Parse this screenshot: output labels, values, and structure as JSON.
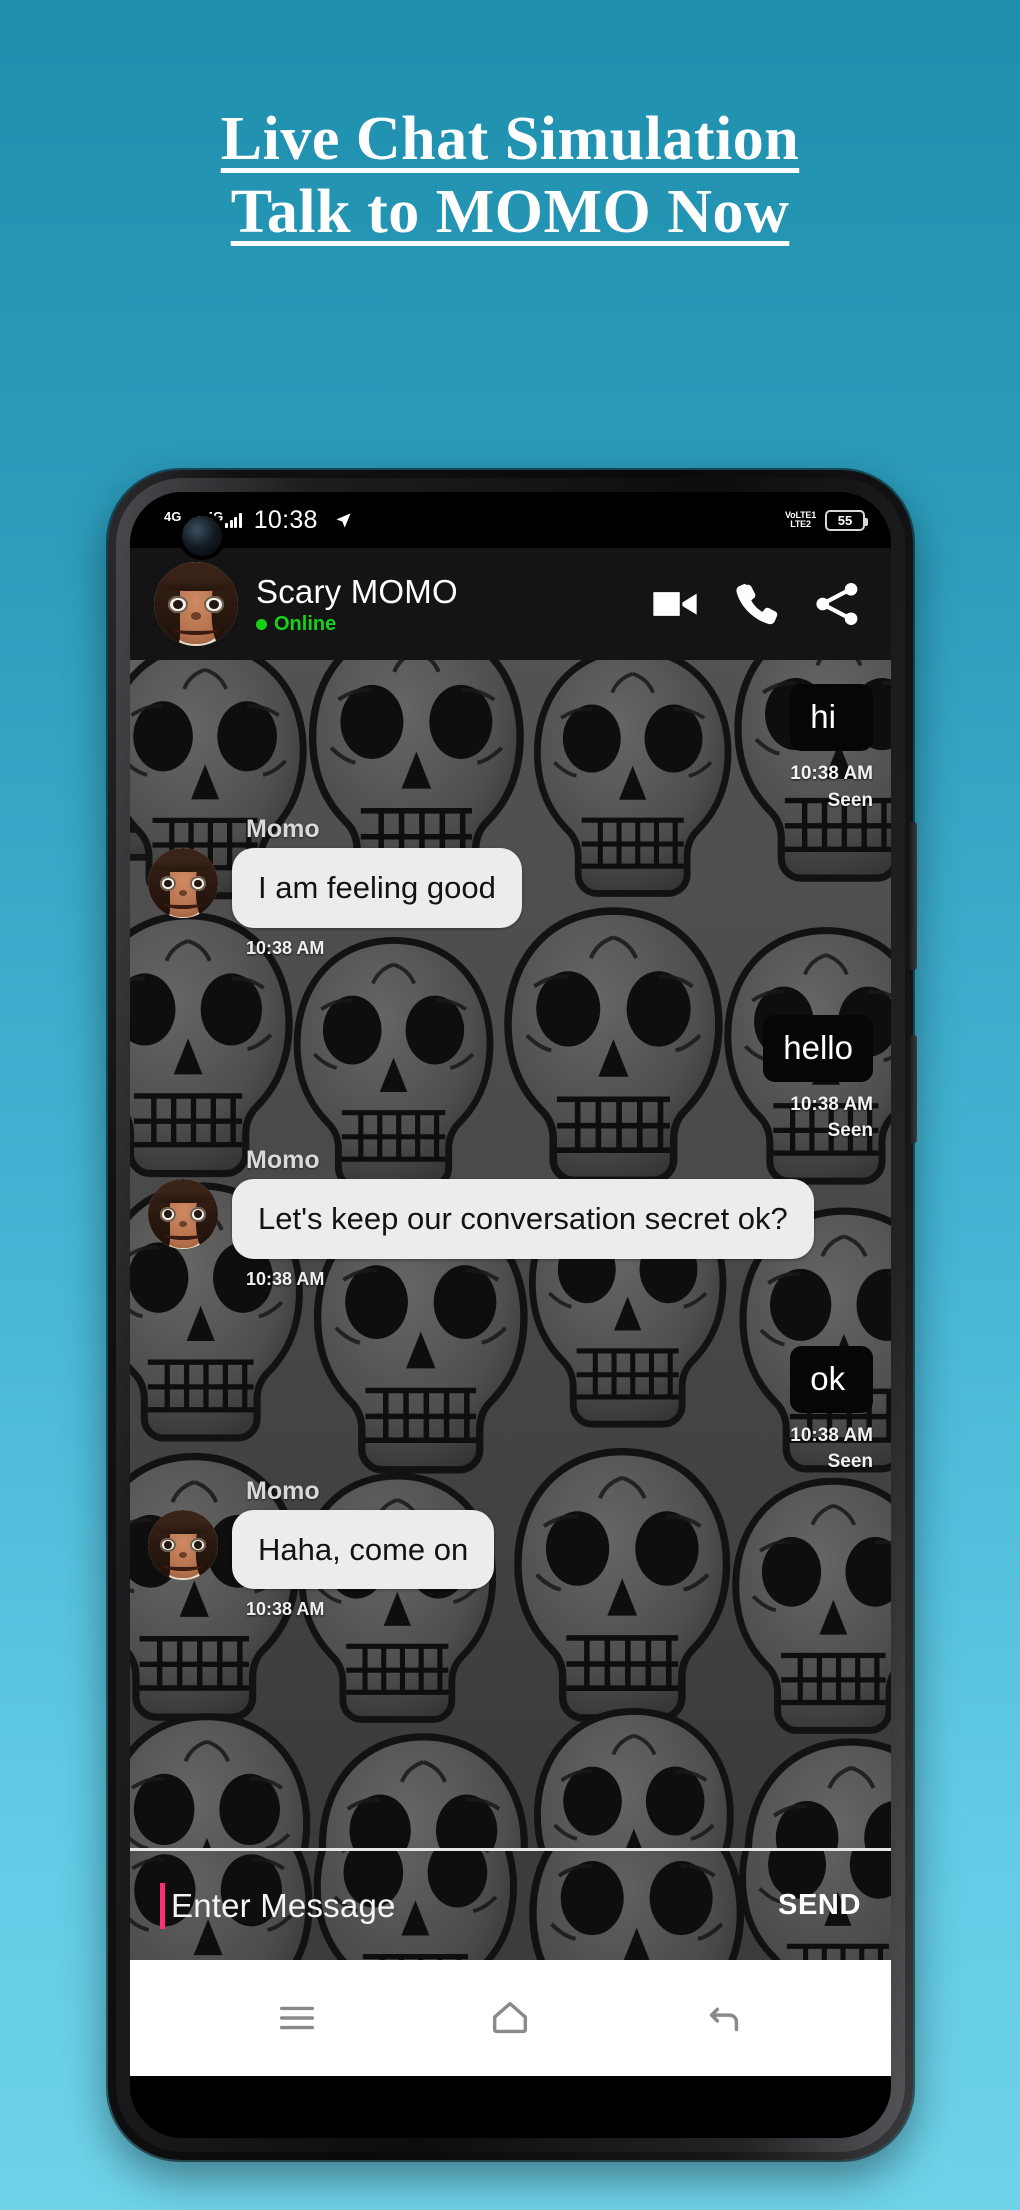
{
  "promo": {
    "headline_line1": "Live Chat Simulation",
    "headline_line2": "Talk to MOMO Now",
    "background_top_color": "#1f8fae",
    "background_bottom_color": "#6fd3ea"
  },
  "status_bar": {
    "network_label_1": "4G",
    "network_label_2": "4G",
    "clock": "10:38",
    "volte_line1": "VoLTE1",
    "volte_line2": "LTE2",
    "battery_level": "55",
    "location_icon": "location-arrow-icon"
  },
  "chat_header": {
    "contact_name": "Scary MOMO",
    "status": "Online",
    "status_color": "#17d119",
    "avatar_icon": "momo-avatar",
    "actions": [
      {
        "name": "video-call-icon",
        "label": "Video call"
      },
      {
        "name": "voice-call-icon",
        "label": "Voice call"
      },
      {
        "name": "share-icon",
        "label": "Share"
      }
    ]
  },
  "conversation": {
    "messages": [
      {
        "id": "m1",
        "direction": "out",
        "text": "hi",
        "time": "10:38 AM",
        "receipt": "Seen"
      },
      {
        "id": "m2",
        "direction": "in",
        "sender": "Momo",
        "text": "I am feeling good",
        "time": "10:38 AM"
      },
      {
        "id": "m3",
        "direction": "out",
        "text": "hello",
        "time": "10:38 AM",
        "receipt": "Seen"
      },
      {
        "id": "m4",
        "direction": "in",
        "sender": "Momo",
        "text": "Let's keep our conversation secret ok?",
        "time": "10:38 AM"
      },
      {
        "id": "m5",
        "direction": "out",
        "text": "ok",
        "time": "10:38 AM",
        "receipt": "Seen"
      },
      {
        "id": "m6",
        "direction": "in",
        "sender": "Momo",
        "text": "Haha, come on",
        "time": "10:38 AM"
      }
    ]
  },
  "composer": {
    "placeholder": "Enter Message",
    "value": "",
    "send_label": "SEND",
    "caret_color": "#ff2d78"
  },
  "nav_bar": {
    "buttons": [
      {
        "name": "recents-icon",
        "label": "Recents"
      },
      {
        "name": "home-icon",
        "label": "Home"
      },
      {
        "name": "back-icon",
        "label": "Back"
      }
    ]
  }
}
